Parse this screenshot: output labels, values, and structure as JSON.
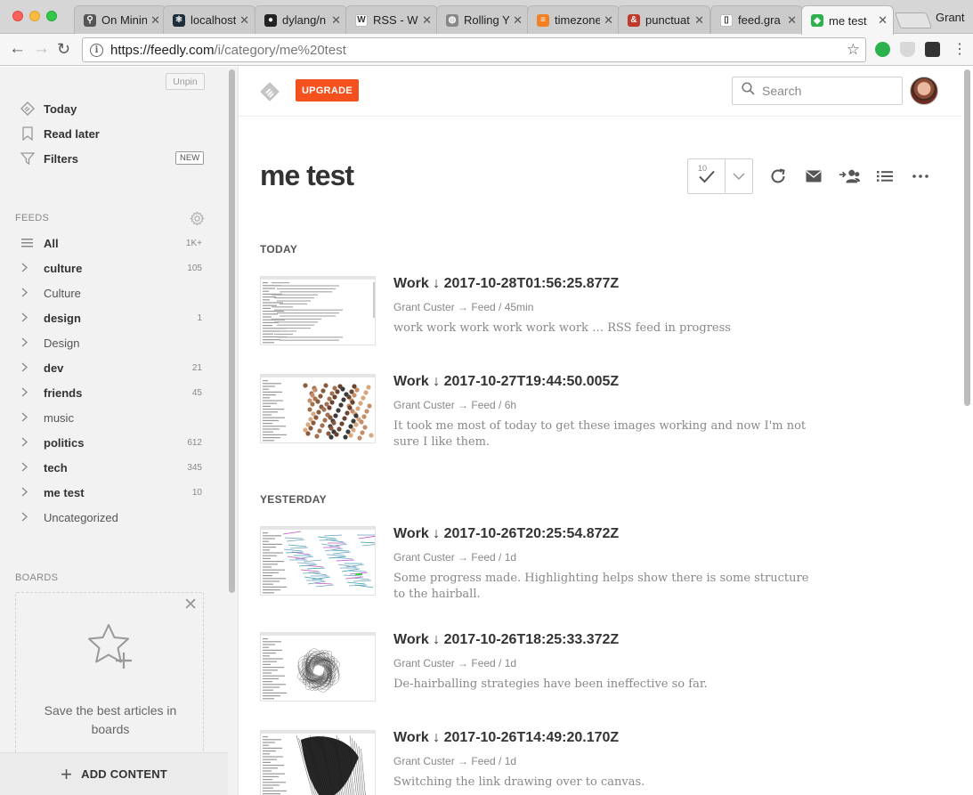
{
  "browser": {
    "tabs": [
      {
        "title": "On Minin",
        "fav_color": "#555555",
        "fav_char": "⚲"
      },
      {
        "title": "localhost",
        "fav_color": "#1d2d3a",
        "fav_char": "⚛"
      },
      {
        "title": "dylang/n",
        "fav_color": "#222222",
        "fav_char": "●"
      },
      {
        "title": "RSS - Wi",
        "fav_color": "#ffffff",
        "fav_char": "W"
      },
      {
        "title": "Rolling Y",
        "fav_color": "#888888",
        "fav_char": "◍"
      },
      {
        "title": "timezone",
        "fav_color": "#f48024",
        "fav_char": "≡"
      },
      {
        "title": "punctuat",
        "fav_color": "#c0392b",
        "fav_char": "&"
      },
      {
        "title": "feed.gra",
        "fav_color": "#ffffff",
        "fav_char": "▯"
      },
      {
        "title": "me test",
        "fav_color": "#2bb24c",
        "fav_char": "◆"
      }
    ],
    "profile_name": "Grant",
    "url_host": "https://feedly.com",
    "url_path": "/i/category/me%20test"
  },
  "sidebar": {
    "unpin_label": "Unpin",
    "nav": [
      {
        "label": "Today",
        "icon": "feedly-icon"
      },
      {
        "label": "Read later",
        "icon": "bookmark-icon"
      },
      {
        "label": "Filters",
        "icon": "filter-icon"
      }
    ],
    "filters_badge": "NEW",
    "feeds_label": "FEEDS",
    "feeds": [
      {
        "name": "All",
        "count": "1K+",
        "bold": true,
        "icon": "list-icon"
      },
      {
        "name": "culture",
        "count": "105",
        "bold": true
      },
      {
        "name": "Culture",
        "count": "",
        "bold": false
      },
      {
        "name": "design",
        "count": "1",
        "bold": true
      },
      {
        "name": "Design",
        "count": "",
        "bold": false
      },
      {
        "name": "dev",
        "count": "21",
        "bold": true
      },
      {
        "name": "friends",
        "count": "45",
        "bold": true
      },
      {
        "name": "music",
        "count": "",
        "bold": false
      },
      {
        "name": "politics",
        "count": "612",
        "bold": true
      },
      {
        "name": "tech",
        "count": "345",
        "bold": true
      },
      {
        "name": "me test",
        "count": "10",
        "bold": true
      },
      {
        "name": "Uncategorized",
        "count": "",
        "bold": false
      }
    ],
    "boards_label": "BOARDS",
    "boards_text": "Save the best articles in boards",
    "add_content_label": "ADD CONTENT"
  },
  "main": {
    "upgrade_label": "UPGRADE",
    "search_placeholder": "Search",
    "title": "me test",
    "unread_count": "10",
    "sections": [
      {
        "label": "TODAY",
        "entries": [
          {
            "title": "Work ↓ 2017-10-28T01:56:25.877Z",
            "meta": "Grant Custer → Feed / 45min",
            "summary": "work work work work work work … RSS feed in progress",
            "thumb": "code"
          },
          {
            "title": "Work ↓ 2017-10-27T19:44:50.005Z",
            "meta": "Grant Custer → Feed / 6h",
            "summary": "It took me most of today to get these images working and now I'm not sure I like them.",
            "thumb": "dots"
          }
        ]
      },
      {
        "label": "YESTERDAY",
        "entries": [
          {
            "title": "Work ↓ 2017-10-26T20:25:54.872Z",
            "meta": "Grant Custer → Feed / 1d",
            "summary": "Some progress made. Highlighting helps show there is some structure to the hairball.",
            "thumb": "hairball-color"
          },
          {
            "title": "Work ↓ 2017-10-26T18:25:33.372Z",
            "meta": "Grant Custer → Feed / 1d",
            "summary": "De-hairballing strategies have been ineffective so far.",
            "thumb": "hairball"
          },
          {
            "title": "Work ↓ 2017-10-26T14:49:20.170Z",
            "meta": "Grant Custer → Feed / 1d",
            "summary": "Switching the link drawing over to canvas.",
            "thumb": "dense"
          }
        ]
      }
    ]
  }
}
